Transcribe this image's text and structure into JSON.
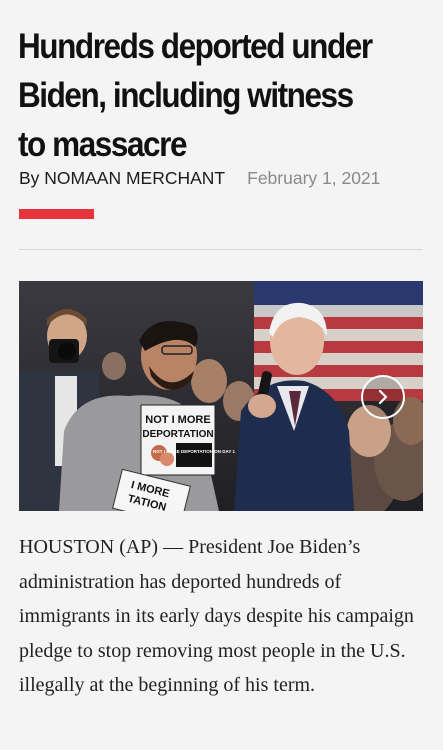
{
  "article": {
    "headline": "Hundreds deported under Biden, including witness to massacre",
    "author": "By NOMAAN MERCHANT",
    "date": "February 1, 2021",
    "body": "HOUSTON (AP) — President Joe Biden’s administration has deported hundreds of immigrants in its early days despite his campaign pledge to stop removing most people in the U.S. illegally at the beginning of his term."
  },
  "photo": {
    "sign_line_1": "NOT I MORE",
    "sign_line_2": "DEPORTATION",
    "sign_small": "NOT I MORE DEPORTATION ON DAY 1",
    "sign2_line_1": "I MORE",
    "sign2_line_2": "TATION"
  },
  "colors": {
    "accent": "#e8323c",
    "date_gray": "#8a8a8a"
  },
  "icons": {
    "next": "chevron-right-icon"
  }
}
